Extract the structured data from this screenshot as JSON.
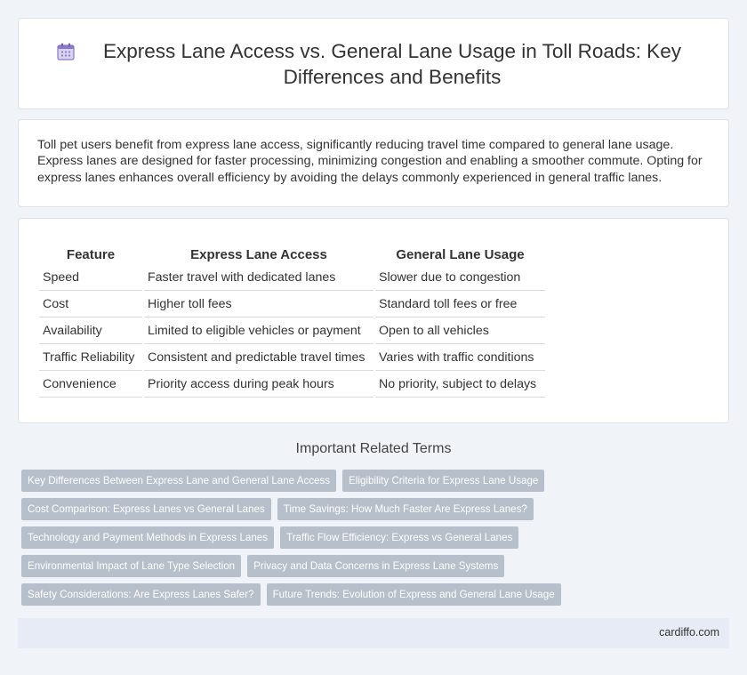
{
  "header": {
    "title": "Express Lane Access vs. General Lane Usage in Toll Roads: Key Differences and Benefits",
    "icon": "calendar-icon",
    "icon_color": "#8a79c9"
  },
  "intro": {
    "text": "Toll pet users benefit from express lane access, significantly reducing travel time compared to general lane usage. Express lanes are designed for faster processing, minimizing congestion and enabling a smoother commute. Opting for express lanes enhances overall efficiency by avoiding the delays commonly experienced in general traffic lanes."
  },
  "table": {
    "headers": [
      "Feature",
      "Express Lane Access",
      "General Lane Usage"
    ],
    "rows": [
      [
        "Speed",
        "Faster travel with dedicated lanes",
        "Slower due to congestion"
      ],
      [
        "Cost",
        "Higher toll fees",
        "Standard toll fees or free"
      ],
      [
        "Availability",
        "Limited to eligible vehicles or payment",
        "Open to all vehicles"
      ],
      [
        "Traffic Reliability",
        "Consistent and predictable travel times",
        "Varies with traffic conditions"
      ],
      [
        "Convenience",
        "Priority access during peak hours",
        "No priority, subject to delays"
      ]
    ]
  },
  "related": {
    "heading": "Important Related Terms",
    "tags": [
      [
        "Key Differences Between Express Lane and General Lane Access",
        "Eligibility Criteria for Express Lane Usage"
      ],
      [
        "Cost Comparison: Express Lanes vs General Lanes",
        "Time Savings: How Much Faster Are Express Lanes?"
      ],
      [
        "Technology and Payment Methods in Express Lanes",
        "Traffic Flow Efficiency: Express vs General Lanes"
      ],
      [
        "Environmental Impact of Lane Type Selection",
        "Privacy and Data Concerns in Express Lane Systems"
      ],
      [
        "Safety Considerations: Are Express Lanes Safer?",
        "Future Trends: Evolution of Express and General Lane Usage"
      ]
    ]
  },
  "footer": {
    "site": "cardiffo.com"
  }
}
